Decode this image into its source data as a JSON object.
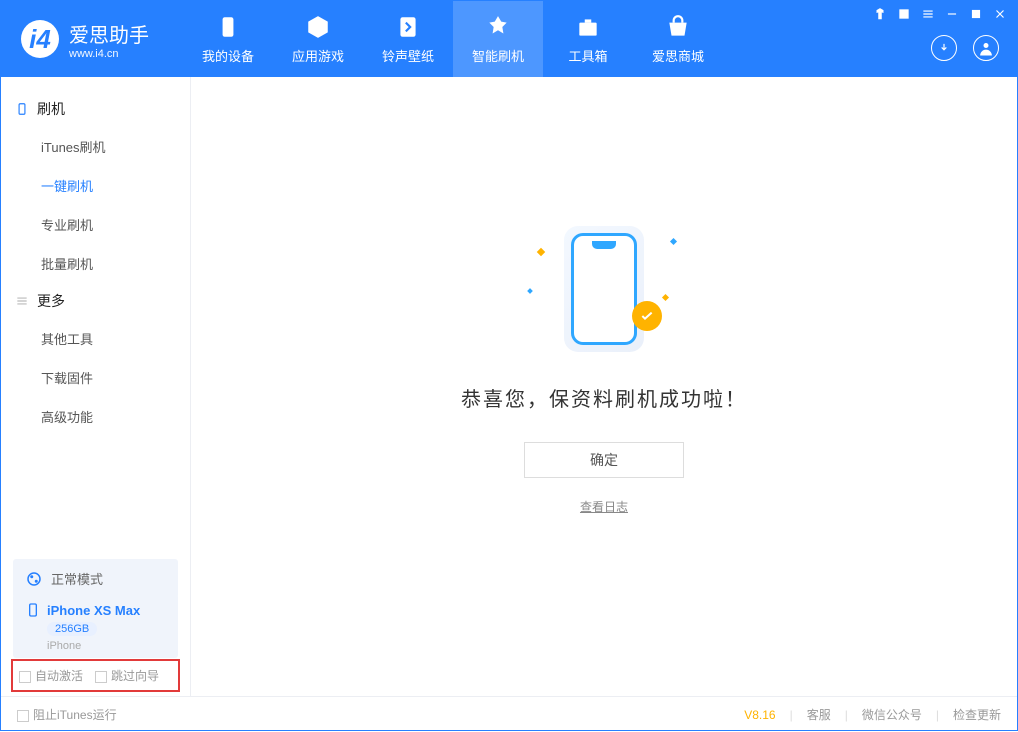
{
  "app": {
    "title": "爱思助手",
    "subtitle": "www.i4.cn"
  },
  "navtabs": [
    {
      "label": "我的设备"
    },
    {
      "label": "应用游戏"
    },
    {
      "label": "铃声壁纸"
    },
    {
      "label": "智能刷机"
    },
    {
      "label": "工具箱"
    },
    {
      "label": "爱思商城"
    }
  ],
  "sidebar": {
    "group1_title": "刷机",
    "group1_items": [
      {
        "label": "iTunes刷机"
      },
      {
        "label": "一键刷机"
      },
      {
        "label": "专业刷机"
      },
      {
        "label": "批量刷机"
      }
    ],
    "group2_title": "更多",
    "group2_items": [
      {
        "label": "其他工具"
      },
      {
        "label": "下载固件"
      },
      {
        "label": "高级功能"
      }
    ]
  },
  "mode": {
    "label": "正常模式"
  },
  "device": {
    "name": "iPhone XS Max",
    "capacity": "256GB",
    "type": "iPhone"
  },
  "checks": {
    "auto_activate": "自动激活",
    "skip_guide": "跳过向导"
  },
  "main": {
    "message": "恭喜您，保资料刷机成功啦！",
    "ok": "确定",
    "log": "查看日志"
  },
  "footer": {
    "block_itunes": "阻止iTunes运行",
    "version": "V8.16",
    "links": [
      "客服",
      "微信公众号",
      "检查更新"
    ]
  }
}
